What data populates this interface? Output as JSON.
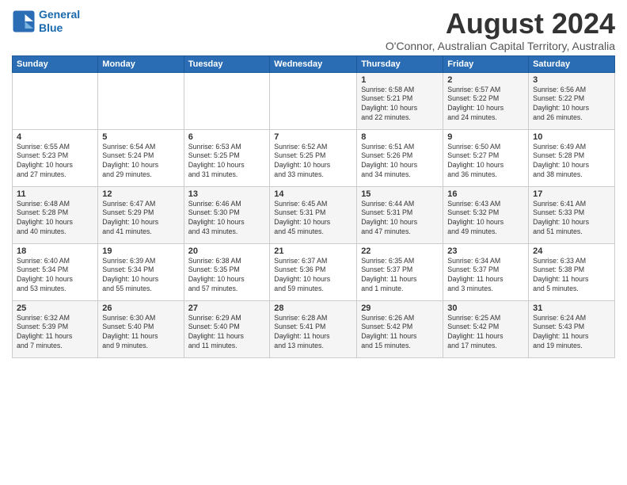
{
  "logo": {
    "line1": "General",
    "line2": "Blue"
  },
  "title": "August 2024",
  "subtitle": "O'Connor, Australian Capital Territory, Australia",
  "days_of_week": [
    "Sunday",
    "Monday",
    "Tuesday",
    "Wednesday",
    "Thursday",
    "Friday",
    "Saturday"
  ],
  "weeks": [
    [
      {
        "num": "",
        "info": ""
      },
      {
        "num": "",
        "info": ""
      },
      {
        "num": "",
        "info": ""
      },
      {
        "num": "",
        "info": ""
      },
      {
        "num": "1",
        "info": "Sunrise: 6:58 AM\nSunset: 5:21 PM\nDaylight: 10 hours\nand 22 minutes."
      },
      {
        "num": "2",
        "info": "Sunrise: 6:57 AM\nSunset: 5:22 PM\nDaylight: 10 hours\nand 24 minutes."
      },
      {
        "num": "3",
        "info": "Sunrise: 6:56 AM\nSunset: 5:22 PM\nDaylight: 10 hours\nand 26 minutes."
      }
    ],
    [
      {
        "num": "4",
        "info": "Sunrise: 6:55 AM\nSunset: 5:23 PM\nDaylight: 10 hours\nand 27 minutes."
      },
      {
        "num": "5",
        "info": "Sunrise: 6:54 AM\nSunset: 5:24 PM\nDaylight: 10 hours\nand 29 minutes."
      },
      {
        "num": "6",
        "info": "Sunrise: 6:53 AM\nSunset: 5:25 PM\nDaylight: 10 hours\nand 31 minutes."
      },
      {
        "num": "7",
        "info": "Sunrise: 6:52 AM\nSunset: 5:25 PM\nDaylight: 10 hours\nand 33 minutes."
      },
      {
        "num": "8",
        "info": "Sunrise: 6:51 AM\nSunset: 5:26 PM\nDaylight: 10 hours\nand 34 minutes."
      },
      {
        "num": "9",
        "info": "Sunrise: 6:50 AM\nSunset: 5:27 PM\nDaylight: 10 hours\nand 36 minutes."
      },
      {
        "num": "10",
        "info": "Sunrise: 6:49 AM\nSunset: 5:28 PM\nDaylight: 10 hours\nand 38 minutes."
      }
    ],
    [
      {
        "num": "11",
        "info": "Sunrise: 6:48 AM\nSunset: 5:28 PM\nDaylight: 10 hours\nand 40 minutes."
      },
      {
        "num": "12",
        "info": "Sunrise: 6:47 AM\nSunset: 5:29 PM\nDaylight: 10 hours\nand 41 minutes."
      },
      {
        "num": "13",
        "info": "Sunrise: 6:46 AM\nSunset: 5:30 PM\nDaylight: 10 hours\nand 43 minutes."
      },
      {
        "num": "14",
        "info": "Sunrise: 6:45 AM\nSunset: 5:31 PM\nDaylight: 10 hours\nand 45 minutes."
      },
      {
        "num": "15",
        "info": "Sunrise: 6:44 AM\nSunset: 5:31 PM\nDaylight: 10 hours\nand 47 minutes."
      },
      {
        "num": "16",
        "info": "Sunrise: 6:43 AM\nSunset: 5:32 PM\nDaylight: 10 hours\nand 49 minutes."
      },
      {
        "num": "17",
        "info": "Sunrise: 6:41 AM\nSunset: 5:33 PM\nDaylight: 10 hours\nand 51 minutes."
      }
    ],
    [
      {
        "num": "18",
        "info": "Sunrise: 6:40 AM\nSunset: 5:34 PM\nDaylight: 10 hours\nand 53 minutes."
      },
      {
        "num": "19",
        "info": "Sunrise: 6:39 AM\nSunset: 5:34 PM\nDaylight: 10 hours\nand 55 minutes."
      },
      {
        "num": "20",
        "info": "Sunrise: 6:38 AM\nSunset: 5:35 PM\nDaylight: 10 hours\nand 57 minutes."
      },
      {
        "num": "21",
        "info": "Sunrise: 6:37 AM\nSunset: 5:36 PM\nDaylight: 10 hours\nand 59 minutes."
      },
      {
        "num": "22",
        "info": "Sunrise: 6:35 AM\nSunset: 5:37 PM\nDaylight: 11 hours\nand 1 minute."
      },
      {
        "num": "23",
        "info": "Sunrise: 6:34 AM\nSunset: 5:37 PM\nDaylight: 11 hours\nand 3 minutes."
      },
      {
        "num": "24",
        "info": "Sunrise: 6:33 AM\nSunset: 5:38 PM\nDaylight: 11 hours\nand 5 minutes."
      }
    ],
    [
      {
        "num": "25",
        "info": "Sunrise: 6:32 AM\nSunset: 5:39 PM\nDaylight: 11 hours\nand 7 minutes."
      },
      {
        "num": "26",
        "info": "Sunrise: 6:30 AM\nSunset: 5:40 PM\nDaylight: 11 hours\nand 9 minutes."
      },
      {
        "num": "27",
        "info": "Sunrise: 6:29 AM\nSunset: 5:40 PM\nDaylight: 11 hours\nand 11 minutes."
      },
      {
        "num": "28",
        "info": "Sunrise: 6:28 AM\nSunset: 5:41 PM\nDaylight: 11 hours\nand 13 minutes."
      },
      {
        "num": "29",
        "info": "Sunrise: 6:26 AM\nSunset: 5:42 PM\nDaylight: 11 hours\nand 15 minutes."
      },
      {
        "num": "30",
        "info": "Sunrise: 6:25 AM\nSunset: 5:42 PM\nDaylight: 11 hours\nand 17 minutes."
      },
      {
        "num": "31",
        "info": "Sunrise: 6:24 AM\nSunset: 5:43 PM\nDaylight: 11 hours\nand 19 minutes."
      }
    ]
  ]
}
